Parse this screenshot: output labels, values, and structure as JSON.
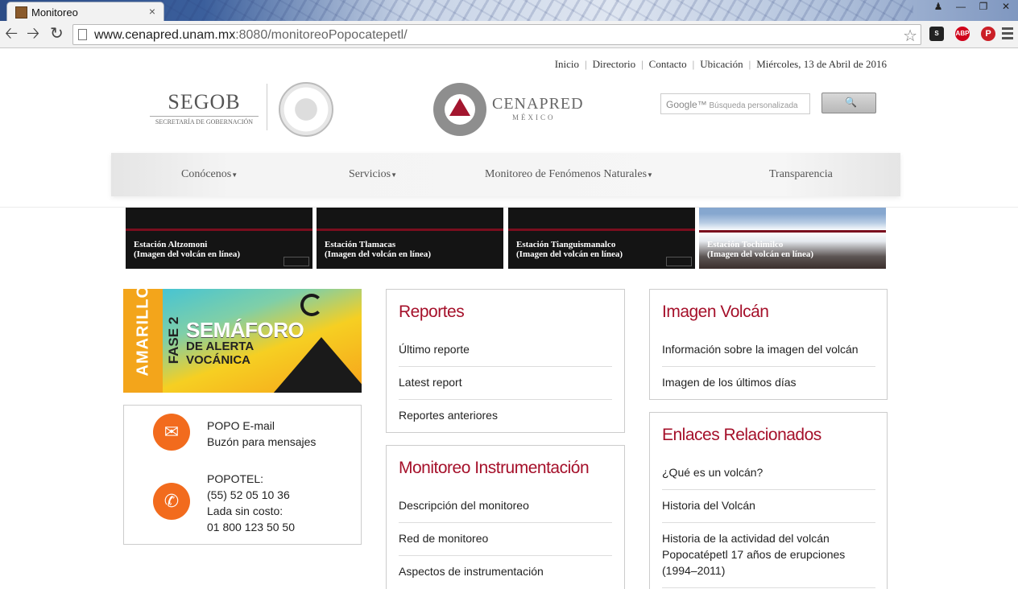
{
  "browser": {
    "tab_title": "Monitoreo",
    "tab_close": "×",
    "url_host": "www.cenapred.unam.mx",
    "url_rest": ":8080/monitoreoPopocatepetl/",
    "ext_s": "S",
    "ext_abp": "ABP",
    "ext_pin": "P"
  },
  "topnav": {
    "items": [
      "Inicio",
      "Directorio",
      "Contacto",
      "Ubicación"
    ],
    "date": "Miércoles, 13 de Abril de 2016"
  },
  "header": {
    "segob_name": "SEGOB",
    "segob_sub": "SECRETARÍA DE GOBERNACIÓN",
    "cenapred_name": "CENAPRED",
    "cenapred_sub": "MÉXICO",
    "search_google": "Google™",
    "search_placeholder": "Búsqueda personalizada"
  },
  "mainnav": {
    "items": [
      "Conócenos",
      "Servicios",
      "Monitoreo de Fenómenos Naturales",
      "Transparencia"
    ]
  },
  "cameras": [
    {
      "station": "Estación Altzomoni",
      "caption": "(Imagen del volcán en línea)"
    },
    {
      "station": "Estación Tlamacas",
      "caption": "(Imagen del volcán en línea)"
    },
    {
      "station": "Estación Tianguismanalco",
      "caption": "(Imagen del volcán en línea)"
    },
    {
      "station": "Estación Tochimilco",
      "caption": "(Imagen del volcán en línea)"
    }
  ],
  "semaforo": {
    "level": "AMARILLO",
    "phase": "FASE 2",
    "title": "SEMÁFORO",
    "line1": "DE ALERTA",
    "line2": "VOCÁNICA"
  },
  "contact": {
    "email_title": "POPO E-mail",
    "email_sub": "Buzón para mensajes",
    "phone_title": "POPOTEL:",
    "phone_number": "(55) 52 05 10 36",
    "toll_free_label": "Lada sin costo:",
    "toll_free_number": "01 800 123 50 50"
  },
  "reportes": {
    "title": "Reportes",
    "items": [
      "Último reporte",
      "Latest report",
      "Reportes anteriores"
    ]
  },
  "monitoreo": {
    "title": "Monitoreo Instrumentación",
    "items": [
      "Descripción del monitoreo",
      "Red de monitoreo",
      "Aspectos de instrumentación"
    ]
  },
  "imagen_volcan": {
    "title": "Imagen Volcán",
    "items": [
      "Información sobre la imagen del volcán",
      "Imagen de los últimos días"
    ]
  },
  "enlaces": {
    "title": "Enlaces Relacionados",
    "items": [
      "¿Qué es un volcán?",
      "Historia del Volcán",
      "Historia de la actividad del volcán Popocatépetl 17 años de erupciones (1994–2011)"
    ]
  }
}
